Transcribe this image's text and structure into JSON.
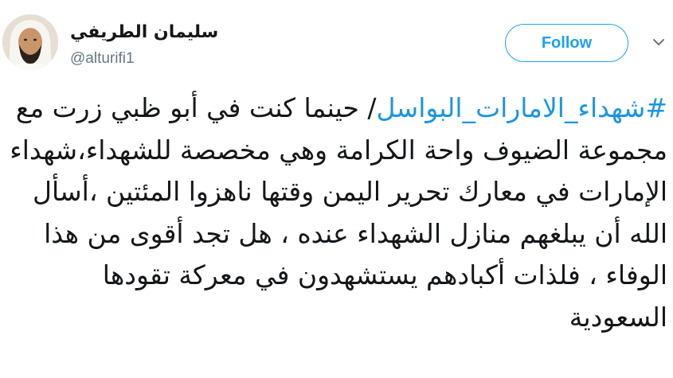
{
  "author": {
    "name": "سليمان الطريفي",
    "handle": "@alturifi1"
  },
  "follow_button": {
    "label": "Follow"
  },
  "icons": {
    "avatar": "profile-photo",
    "more": "chevron-down-icon"
  },
  "colors": {
    "accent": "#1da1f2",
    "hashtag": "#1b95e0",
    "text": "#14171a",
    "secondary_text": "#657786"
  },
  "tweet": {
    "hashtag": "#شهداء_الامارات_البواسل",
    "body": "/ حينما كنت في أبو ظبي زرت مع مجموعة الضيوف واحة الكرامة وهي مخصصة للشهداء،شهداء الإمارات في معارك تحرير اليمن وقتها ناهزوا المئتين ،أسأل الله أن يبلغهم منازل الشهداء عنده ، هل تجد أقوى من هذا الوفاء ، فلذات أكبادهم يستشهدون في معركة تقودها السعودية"
  }
}
